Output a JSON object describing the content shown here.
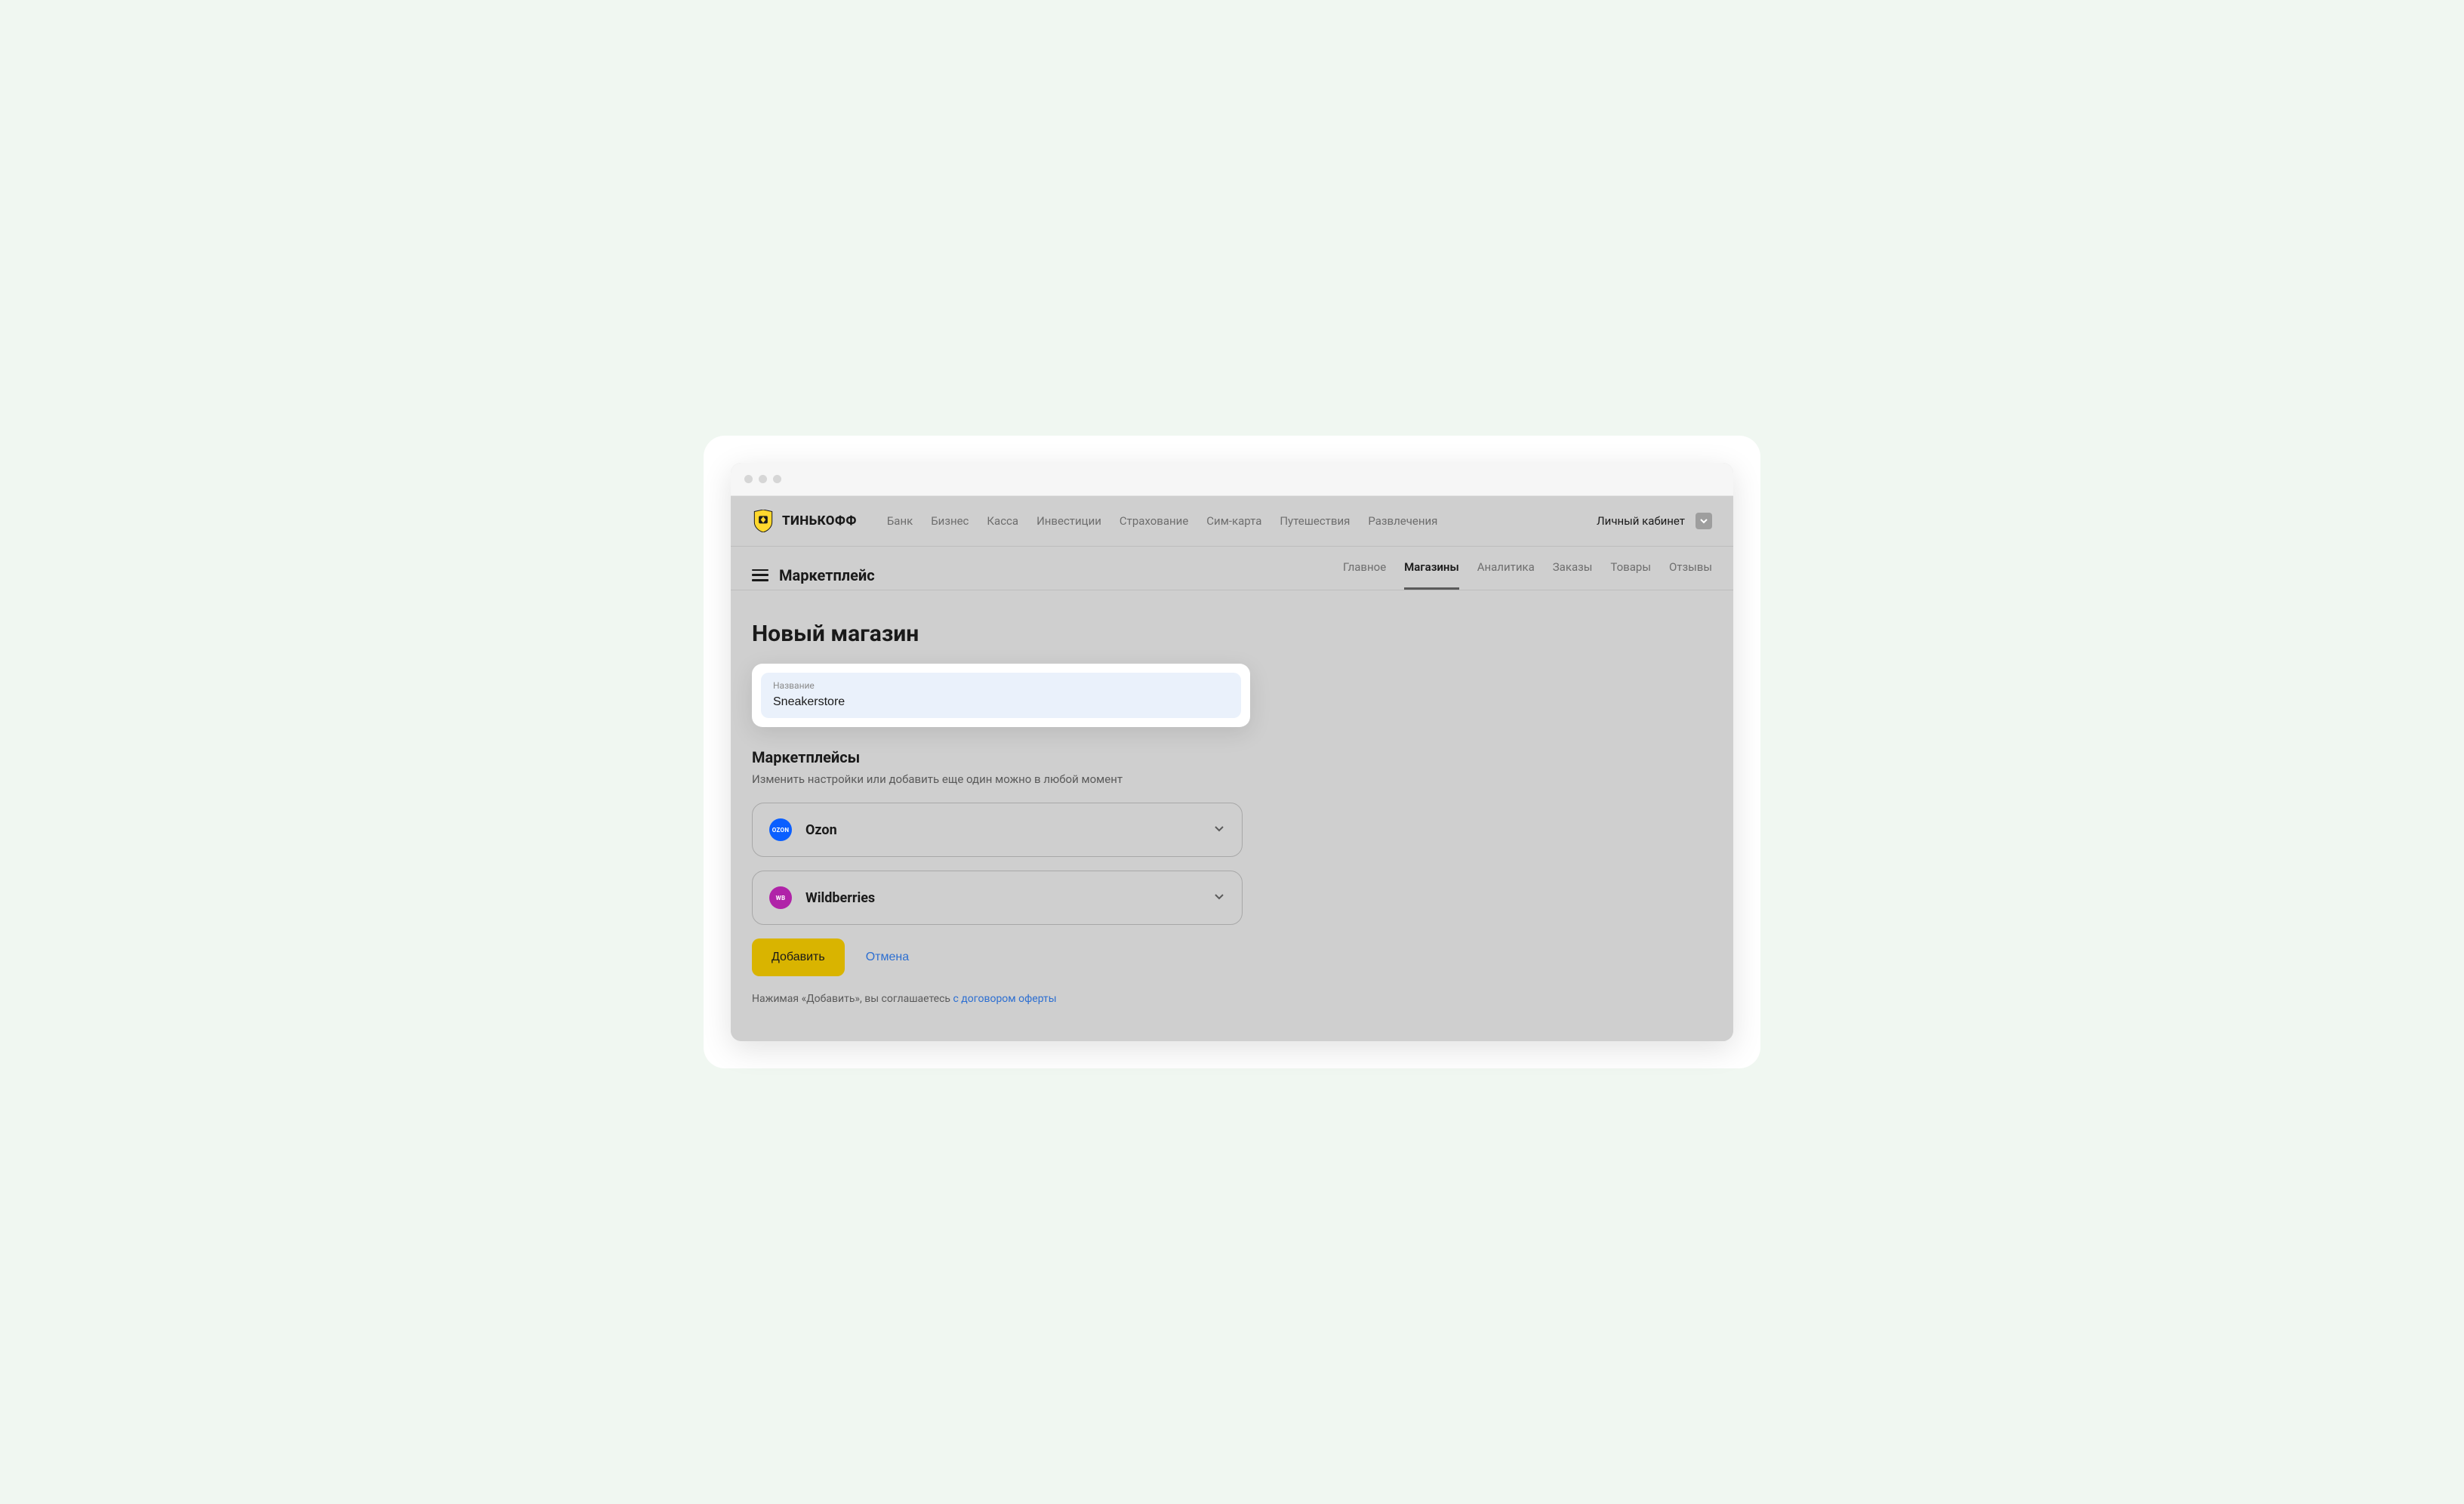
{
  "brand": {
    "name": "ТИНЬКОФФ"
  },
  "topnav": {
    "items": [
      "Банк",
      "Бизнес",
      "Касса",
      "Инвестиции",
      "Страхование",
      "Сим-карта",
      "Путешествия",
      "Развлечения"
    ],
    "account": "Личный кабинет"
  },
  "subbar": {
    "title": "Маркетплейс",
    "items": [
      "Главное",
      "Магазины",
      "Аналитика",
      "Заказы",
      "Товары",
      "Отзывы"
    ],
    "active_index": 1
  },
  "page": {
    "title": "Новый магазин",
    "name_field": {
      "label": "Название",
      "value": "Sneakerstore"
    },
    "marketplaces": {
      "heading": "Маркетплейсы",
      "sub": "Изменить настройки или добавить еще один можно в любой момент",
      "items": [
        {
          "name": "Ozon",
          "logo_text": "OZON",
          "color": "#0b5fff"
        },
        {
          "name": "Wildberries",
          "logo_text": "WB",
          "color": "#b023a8"
        }
      ]
    },
    "actions": {
      "primary": "Добавить",
      "cancel": "Отмена"
    },
    "consent": {
      "prefix": "Нажимая «Добавить», вы соглашаетесь ",
      "link": "с договором оферты"
    }
  }
}
